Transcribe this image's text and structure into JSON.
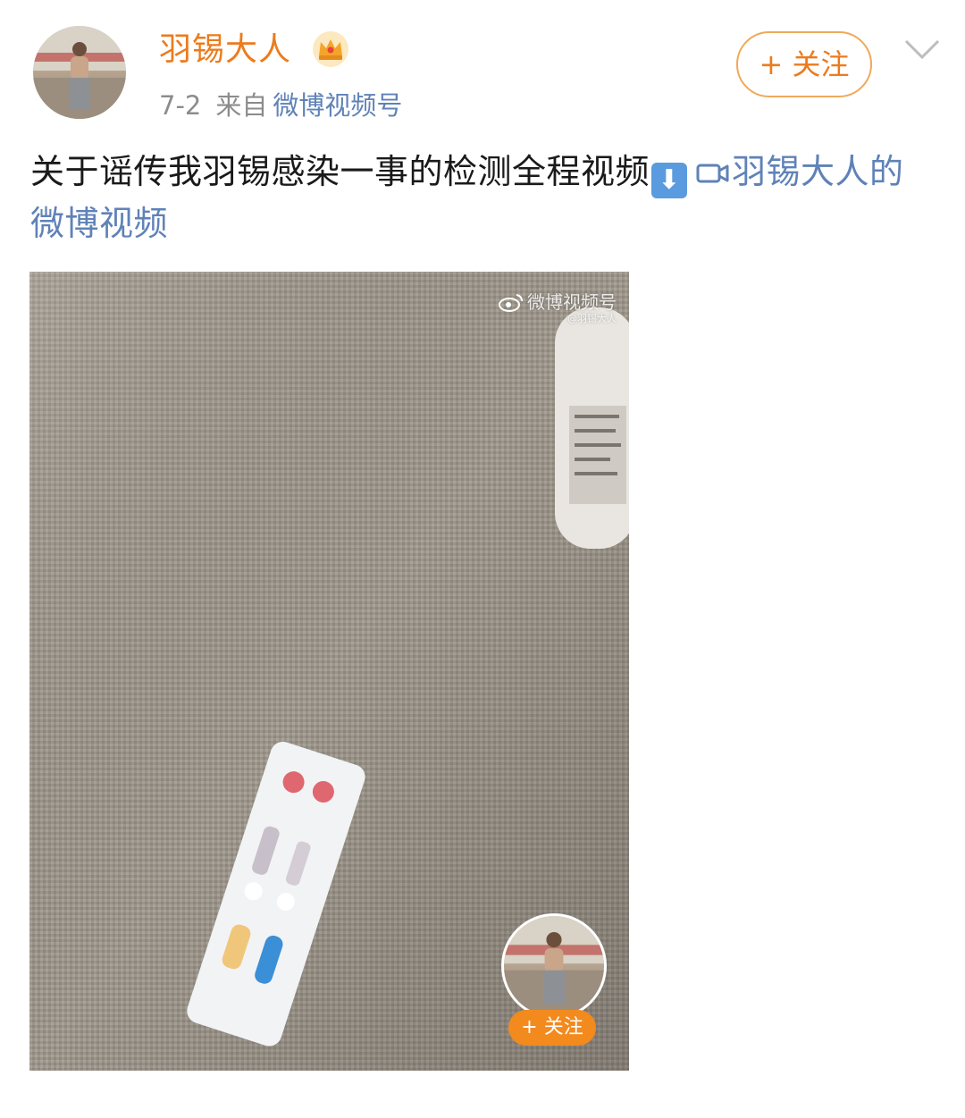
{
  "header": {
    "username": "羽锡大人",
    "verified_badge_icon": "crown-icon",
    "date": "7-2",
    "source_prefix": "来自",
    "source_name": "微博视频号",
    "follow_label": "+ 关注",
    "menu_icon": "chevron-down-icon"
  },
  "post": {
    "text": "关于谣传我羽锡感染一事的检测全程视频",
    "emoji_icon": "down-arrow-emoji-icon",
    "emoji_glyph": "⬇",
    "video_link": "羽锡大人的微博视频",
    "video_link_icon": "video-camera-icon"
  },
  "video": {
    "watermark_brand": "微博视频号",
    "watermark_user": "@羽锡大人",
    "follow_label": "+ 关注"
  },
  "colors": {
    "accent_orange": "#ec7b1c",
    "link_blue": "#5f82b7",
    "meta_gray": "#8c8c8c"
  }
}
